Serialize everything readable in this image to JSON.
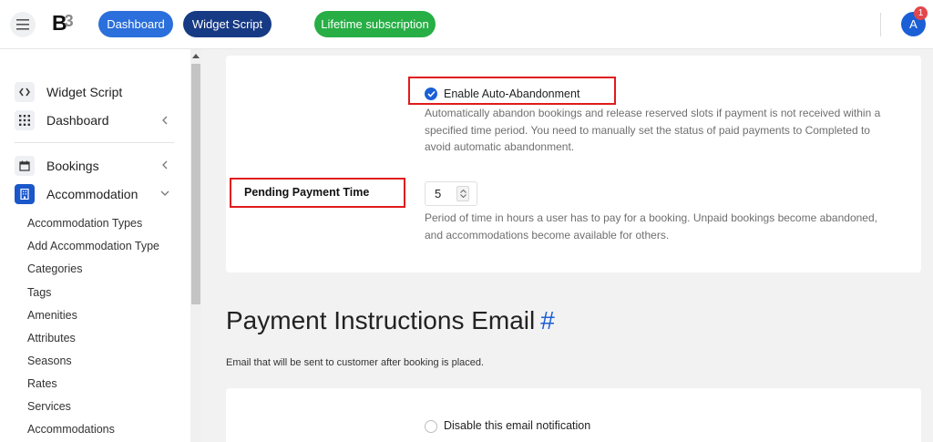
{
  "header": {
    "logo_text": "B",
    "logo_sub": "3",
    "nav": {
      "dashboard": "Dashboard",
      "widget_script": "Widget Script",
      "lifetime": "Lifetime subscription"
    },
    "user_initial": "A",
    "notification_count": "1",
    "colors": {
      "dashboard": "#2a6fdb",
      "widget": "#173a84",
      "lifetime": "#27ae45"
    }
  },
  "sidebar": {
    "items": [
      {
        "label": "Widget Script",
        "icon": "code-icon"
      },
      {
        "label": "Dashboard",
        "icon": "grid-icon"
      },
      {
        "label": "Bookings",
        "icon": "calendar-icon"
      },
      {
        "label": "Accommodation",
        "icon": "building-icon"
      }
    ],
    "sub_items": [
      "Accommodation Types",
      "Add Accommodation Type",
      "Categories",
      "Tags",
      "Amenities",
      "Attributes",
      "Seasons",
      "Rates",
      "Services",
      "Accommodations"
    ]
  },
  "main": {
    "auto_abandon": {
      "label": "Enable Auto-Abandonment",
      "checked": true,
      "description": "Automatically abandon bookings and release reserved slots if payment is not received within a specified time period. You need to manually set the status of paid payments to Completed to avoid automatic abandonment."
    },
    "pending_payment": {
      "label": "Pending Payment Time",
      "value": "5",
      "description": "Period of time in hours a user has to pay for a booking. Unpaid bookings become abandoned, and accommodations become available for others."
    },
    "section": {
      "title": "Payment Instructions Email",
      "hash": "#",
      "description": "Email that will be sent to customer after booking is placed."
    },
    "disable_email": {
      "label": "Disable this email notification",
      "checked": false
    }
  }
}
